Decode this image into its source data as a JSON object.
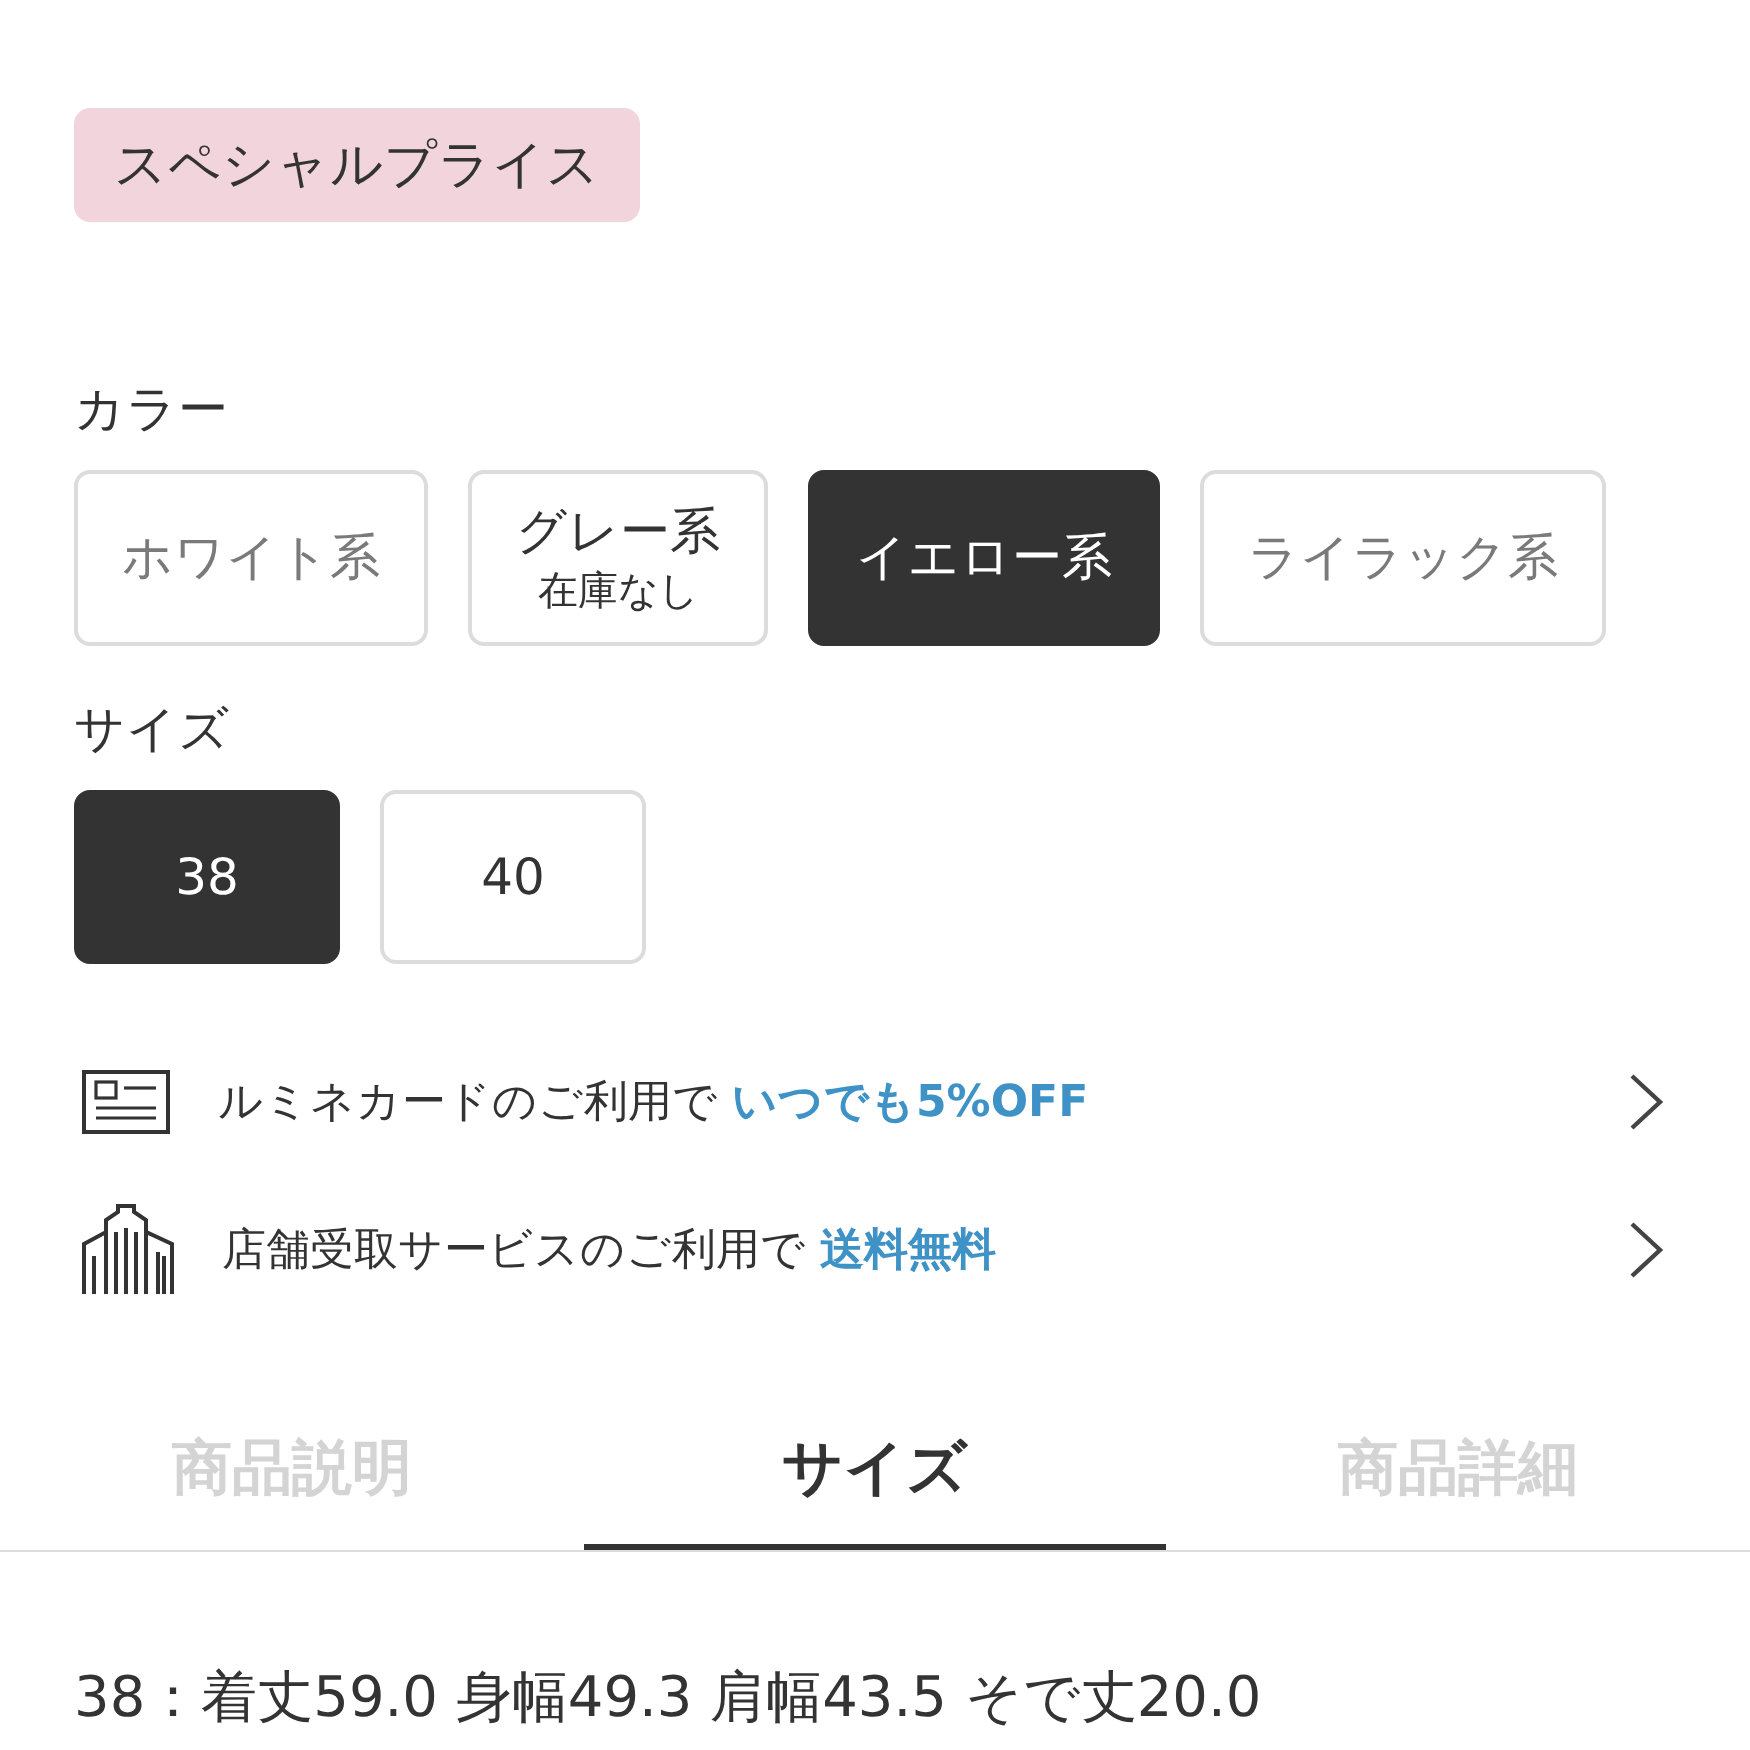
{
  "badge": {
    "label": "スペシャルプライス"
  },
  "color_options": {
    "label": "カラー",
    "items": [
      {
        "label": "ホワイト系",
        "selected": false,
        "muted": true
      },
      {
        "label": "グレー系",
        "note": "在庫なし",
        "selected": false,
        "muted": false
      },
      {
        "label": "イエロー系",
        "selected": true,
        "muted": false
      },
      {
        "label": "ライラック系",
        "selected": false,
        "muted": true
      }
    ]
  },
  "size_options": {
    "label": "サイズ",
    "items": [
      {
        "label": "38",
        "selected": true
      },
      {
        "label": "40",
        "selected": false
      }
    ]
  },
  "promos": [
    {
      "kind": "card",
      "text": "ルミネカードのご利用で **いつでも5%OFF**"
    },
    {
      "kind": "store",
      "text": "店舗受取サービスのご利用で **送料無料**"
    }
  ],
  "tabs": [
    {
      "label": "商品説明",
      "selected": false
    },
    {
      "label": "サイズ",
      "selected": true
    },
    {
      "label": "商品詳細",
      "selected": false
    }
  ],
  "size_text": "38：着丈59.0 身幅49.3 肩幅43.5 そで丈20.0"
}
